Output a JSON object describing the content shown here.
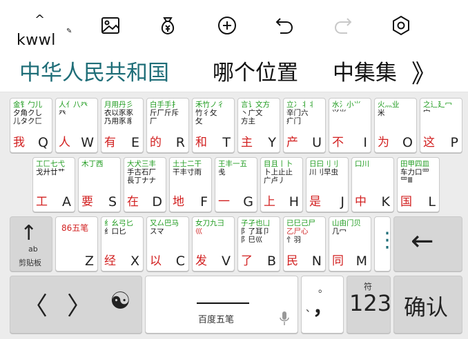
{
  "toolbar": {
    "brand_caret": "^",
    "brand_text": "kwwl",
    "brand_pen": "✎",
    "icons": [
      "image-icon",
      "money-bag-icon",
      "add-circle-icon",
      "undo-icon",
      "redo-icon",
      "settings-hexagon-icon"
    ]
  },
  "candidates": {
    "main": "中华人民共和国",
    "items": [
      "哪个位置",
      "中集集"
    ],
    "more": "》"
  },
  "keyboard": {
    "rows": [
      [
        {
          "letter": "Q",
          "code": "我",
          "roots": [
            "金钅勹儿",
            "夕角クし",
            "儿タク匚"
          ]
        },
        {
          "letter": "W",
          "code": "人",
          "roots": [
            "人亻八癶",
            "癶",
            ""
          ]
        },
        {
          "letter": "E",
          "code": "有",
          "roots": [
            "月用丹彡",
            "衣以豕豖",
            "乃用豕豸"
          ]
        },
        {
          "letter": "R",
          "code": "的",
          "roots": [
            "白手手扌",
            "斤厂斤斥",
            "厂"
          ]
        },
        {
          "letter": "T",
          "code": "和",
          "roots": [
            "禾竹ノ彳",
            "竹彳攵",
            "攵"
          ]
        },
        {
          "letter": "Y",
          "code": "主",
          "roots": [
            "言讠文方",
            "丶广文",
            "方主"
          ]
        },
        {
          "letter": "U",
          "code": "产",
          "roots": [
            "立冫丬丬",
            "辛门六",
            "疒门"
          ]
        },
        {
          "letter": "I",
          "code": "不",
          "roots": [
            "水氵小⺌",
            "⺍⺌",
            ""
          ]
        },
        {
          "letter": "O",
          "code": "为",
          "roots": [
            "火灬业",
            "米",
            ""
          ]
        },
        {
          "letter": "P",
          "code": "这",
          "roots": [
            "之辶廴冖",
            "宀",
            ""
          ]
        }
      ],
      [
        {
          "letter": "A",
          "code": "工",
          "roots": [
            "工匚七弋",
            "戈廾廿艹",
            ""
          ]
        },
        {
          "letter": "S",
          "code": "要",
          "roots": [
            "木丁西",
            "",
            ""
          ]
        },
        {
          "letter": "D",
          "code": "在",
          "roots": [
            "大犬三丰",
            "手古石厂",
            "長丁ナナ"
          ]
        },
        {
          "letter": "F",
          "code": "地",
          "roots": [
            "土士二干",
            "干丰寸雨",
            ""
          ]
        },
        {
          "letter": "G",
          "code": "一",
          "roots": [
            "王丰一五",
            "戋",
            ""
          ]
        },
        {
          "letter": "H",
          "code": "上",
          "roots": [
            "目且丨卜",
            "卜上止止",
            "广卢丿"
          ]
        },
        {
          "letter": "J",
          "code": "是",
          "roots": [
            "日曰刂刂",
            "川刂早虫",
            ""
          ]
        },
        {
          "letter": "K",
          "code": "中",
          "roots": [
            "口川",
            "",
            ""
          ]
        },
        {
          "letter": "L",
          "code": "国",
          "roots": [
            "田甲四皿",
            "车力口罒",
            "罒Ⅲ"
          ]
        }
      ],
      [
        {
          "letter": "Z",
          "code": "",
          "roots": [
            "86五笔",
            "",
            ""
          ]
        },
        {
          "letter": "X",
          "code": "经",
          "roots": [
            "纟幺弓匕",
            "纟口匕",
            ""
          ]
        },
        {
          "letter": "C",
          "code": "以",
          "roots": [
            "又厶巴马",
            "スマ",
            ""
          ]
        },
        {
          "letter": "V",
          "code": "发",
          "roots": [
            "女刀九彐",
            "巛",
            ""
          ]
        },
        {
          "letter": "B",
          "code": "了",
          "roots": [
            "子孑也凵",
            "阝了耳卩",
            "阝巳巛"
          ]
        },
        {
          "letter": "N",
          "code": "民",
          "roots": [
            "已巳己尸",
            "乙尸心",
            "忄羽"
          ]
        },
        {
          "letter": "M",
          "code": "同",
          "roots": [
            "山由门贝",
            "几冖",
            ""
          ]
        }
      ]
    ],
    "clipboard_label": "剪贴板",
    "clipboard_ab": "ab",
    "clipboard_arrow": "↑",
    "more_dots": "⋮",
    "backspace": "←",
    "left_arrow": "〈",
    "right_arrow": "〉",
    "yinyang": "☯",
    "space_label": "百度五笔",
    "punct_top": "。",
    "punct_main": "，",
    "punct_mid": "、",
    "num_label": "123",
    "num_sup": "符",
    "confirm_label": "确认"
  }
}
